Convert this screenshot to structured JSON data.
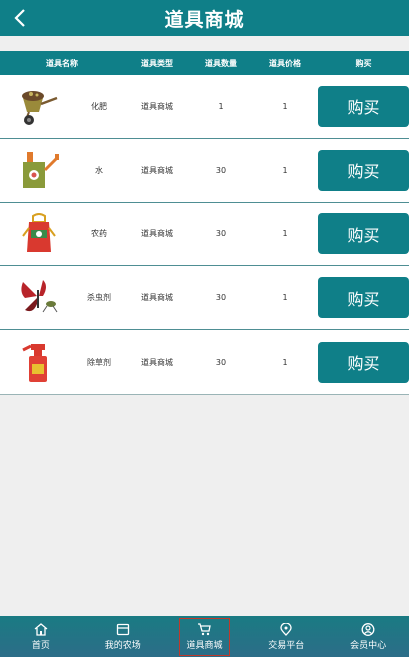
{
  "header": {
    "title": "道具商城",
    "back_icon": "chevron-left-icon"
  },
  "table": {
    "headers": [
      "道具名称",
      "道具类型",
      "道具数量",
      "道具价格",
      "购买"
    ],
    "rows": [
      {
        "icon": "wheelbarrow-icon",
        "name": "化肥",
        "type": "道具商城",
        "quantity": "1",
        "price": "1",
        "buy": "购买"
      },
      {
        "icon": "watering-can-icon",
        "name": "水",
        "type": "道具商城",
        "quantity": "30",
        "price": "1",
        "buy": "购买"
      },
      {
        "icon": "apron-icon",
        "name": "农药",
        "type": "道具商城",
        "quantity": "30",
        "price": "1",
        "buy": "购买"
      },
      {
        "icon": "insects-icon",
        "name": "杀虫剂",
        "type": "道具商城",
        "quantity": "30",
        "price": "1",
        "buy": "购买"
      },
      {
        "icon": "spray-bottle-icon",
        "name": "除草剂",
        "type": "道具商城",
        "quantity": "30",
        "price": "1",
        "buy": "购买"
      }
    ]
  },
  "tabbar": {
    "items": [
      {
        "label": "首页",
        "icon": "home-icon"
      },
      {
        "label": "我的农场",
        "icon": "shop-icon"
      },
      {
        "label": "道具商城",
        "icon": "cart-icon",
        "active": true
      },
      {
        "label": "交易平台",
        "icon": "location-pin-icon"
      },
      {
        "label": "会员中心",
        "icon": "user-icon"
      }
    ]
  },
  "colors": {
    "primary": "#0f7f88",
    "background": "#efefef",
    "active_outline": "#c0392b"
  }
}
